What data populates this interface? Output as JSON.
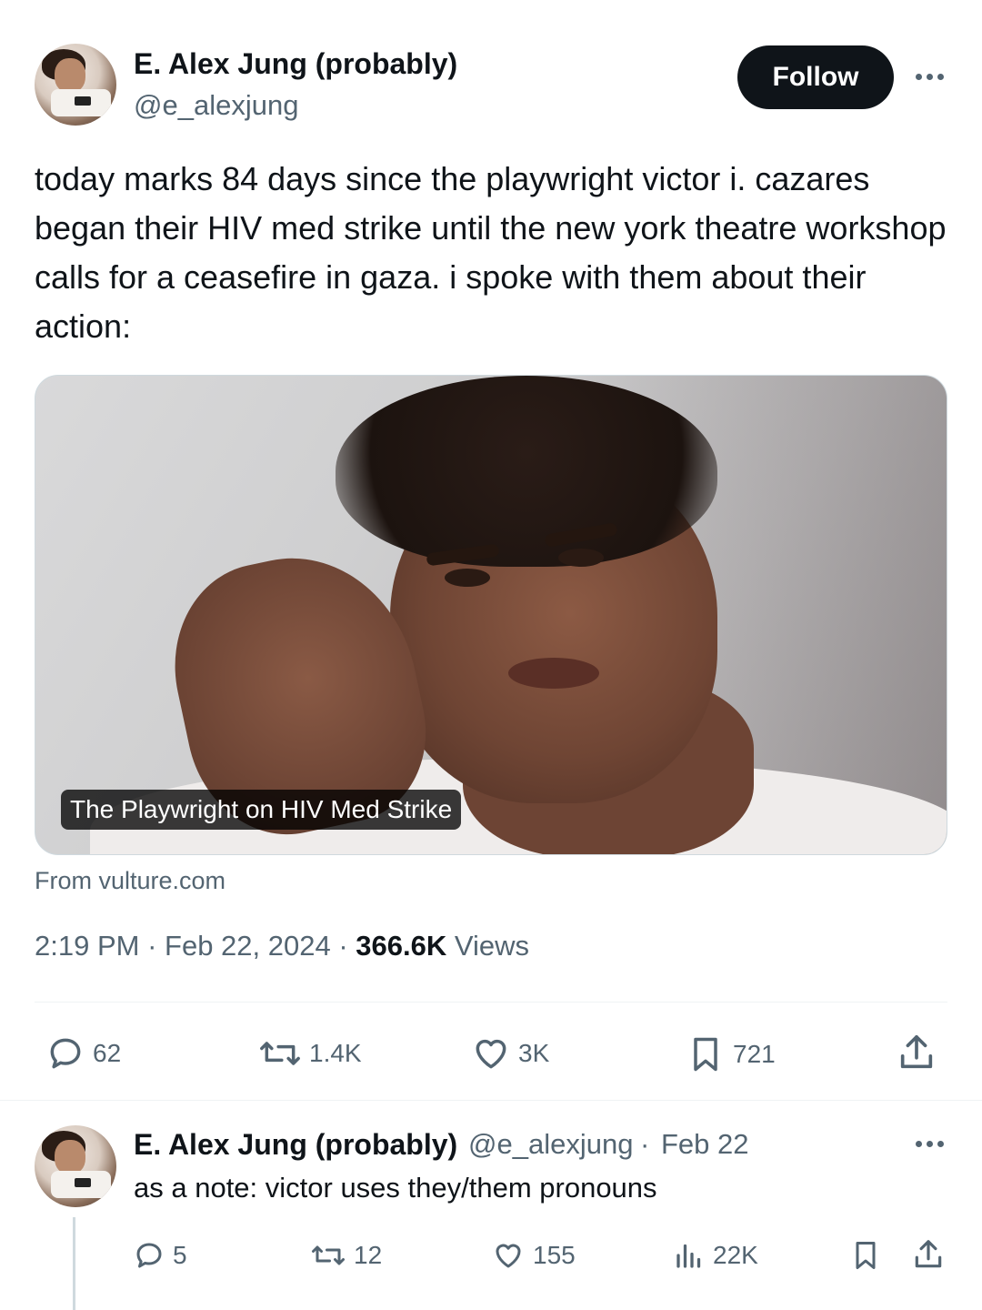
{
  "tweet": {
    "author_name": "E. Alex Jung (probably)",
    "author_handle": "@e_alexjung",
    "follow_label": "Follow",
    "text": "today marks 84 days since the playwright victor i. cazares began their HIV med strike until the new york theatre workshop calls for a ceasefire in gaza. i spoke with them about their action:",
    "media": {
      "caption": "The Playwright on HIV Med Strike",
      "source": "From vulture.com"
    },
    "time": "2:19 PM",
    "date": "Feb 22, 2024",
    "views_count": "366.6K",
    "views_label": "Views",
    "actions": {
      "replies": "62",
      "reposts": "1.4K",
      "likes": "3K",
      "bookmarks": "721"
    }
  },
  "reply": {
    "author_name": "E. Alex Jung (probably)",
    "author_handle": "@e_alexjung",
    "date": "Feb 22",
    "text": "as a note: victor uses they/them pronouns",
    "actions": {
      "replies": "5",
      "reposts": "12",
      "likes": "155",
      "views": "22K"
    }
  },
  "colors": {
    "text_primary": "#0f1419",
    "text_secondary": "#536471",
    "follow_bg": "#0f1419",
    "divider": "#eff3f4"
  },
  "icons": [
    "avatar",
    "more-icon",
    "reply-icon",
    "repost-icon",
    "like-icon",
    "bookmark-icon",
    "share-icon",
    "views-icon"
  ]
}
